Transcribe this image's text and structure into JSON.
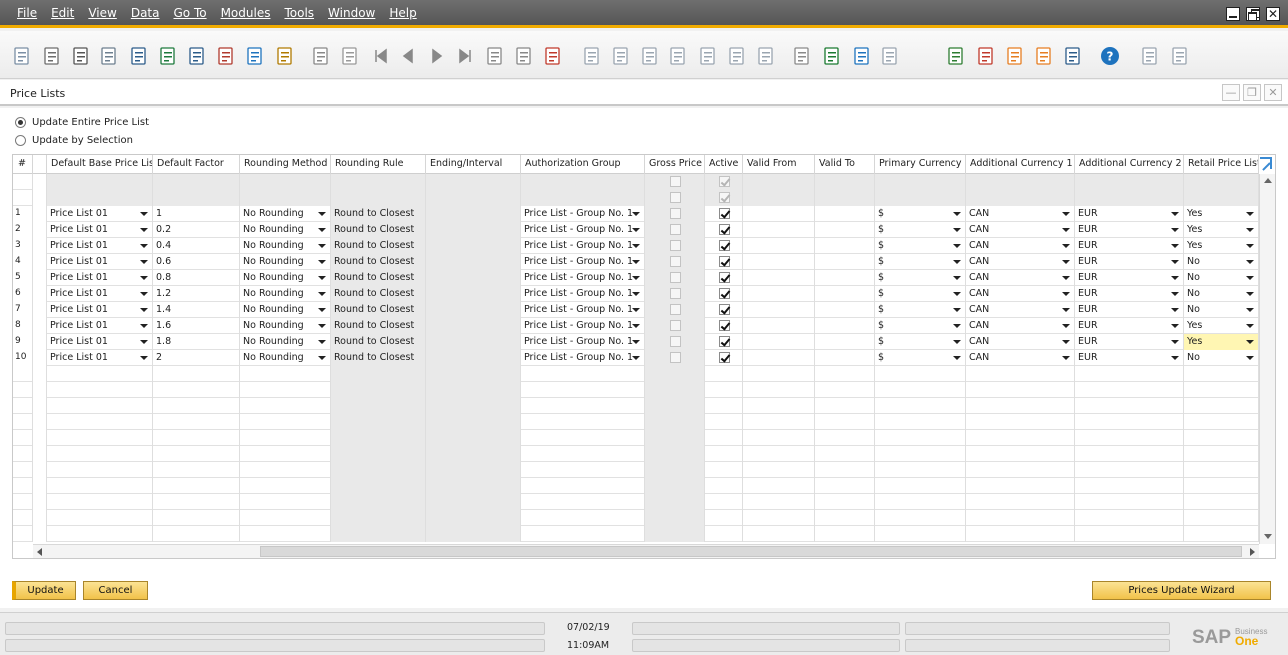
{
  "menu": {
    "items": [
      {
        "label": "File"
      },
      {
        "label": "Edit"
      },
      {
        "label": "View"
      },
      {
        "label": "Data"
      },
      {
        "label": "Go To"
      },
      {
        "label": "Modules"
      },
      {
        "label": "Tools"
      },
      {
        "label": "Window"
      },
      {
        "label": "Help"
      }
    ]
  },
  "window_controls": {
    "minimize": "_",
    "restore": "",
    "close": "✕"
  },
  "form": {
    "title": "Price Lists",
    "controls": {
      "minimize": "—",
      "restore": "❐",
      "close": "✕"
    }
  },
  "options": {
    "update_entire": "Update Entire Price List",
    "update_by_selection": "Update by Selection",
    "selected": "update_entire"
  },
  "grid": {
    "headers": [
      "#",
      "Default Base Price List",
      "Default Factor",
      "Rounding Method",
      "Rounding Rule",
      "Ending/Interval",
      "Authorization Group",
      "Gross Price",
      "Active",
      "Valid From",
      "Valid To",
      "Primary Currency",
      "Additional Currency 1",
      "Additional Currency 2",
      "Retail Price List"
    ],
    "rows": [
      {
        "num": "1",
        "base": "Price List 01",
        "factor": "1",
        "method": "No Rounding",
        "rule": "Round to Closest",
        "auth": "Price List - Group No. 1",
        "gross": false,
        "active": true,
        "primary": "$",
        "add1": "CAN",
        "add2": "EUR",
        "retail": "Yes"
      },
      {
        "num": "2",
        "base": "Price List 01",
        "factor": "0.2",
        "method": "No Rounding",
        "rule": "Round to Closest",
        "auth": "Price List - Group No. 1",
        "gross": false,
        "active": true,
        "primary": "$",
        "add1": "CAN",
        "add2": "EUR",
        "retail": "Yes"
      },
      {
        "num": "3",
        "base": "Price List 01",
        "factor": "0.4",
        "method": "No Rounding",
        "rule": "Round to Closest",
        "auth": "Price List - Group No. 1",
        "gross": false,
        "active": true,
        "primary": "$",
        "add1": "CAN",
        "add2": "EUR",
        "retail": "Yes"
      },
      {
        "num": "4",
        "base": "Price List 01",
        "factor": "0.6",
        "method": "No Rounding",
        "rule": "Round to Closest",
        "auth": "Price List - Group No. 1",
        "gross": false,
        "active": true,
        "primary": "$",
        "add1": "CAN",
        "add2": "EUR",
        "retail": "No"
      },
      {
        "num": "5",
        "base": "Price List 01",
        "factor": "0.8",
        "method": "No Rounding",
        "rule": "Round to Closest",
        "auth": "Price List - Group No. 1",
        "gross": false,
        "active": true,
        "primary": "$",
        "add1": "CAN",
        "add2": "EUR",
        "retail": "No"
      },
      {
        "num": "6",
        "base": "Price List 01",
        "factor": "1.2",
        "method": "No Rounding",
        "rule": "Round to Closest",
        "auth": "Price List - Group No. 1",
        "gross": false,
        "active": true,
        "primary": "$",
        "add1": "CAN",
        "add2": "EUR",
        "retail": "No"
      },
      {
        "num": "7",
        "base": "Price List 01",
        "factor": "1.4",
        "method": "No Rounding",
        "rule": "Round to Closest",
        "auth": "Price List - Group No. 1",
        "gross": false,
        "active": true,
        "primary": "$",
        "add1": "CAN",
        "add2": "EUR",
        "retail": "No"
      },
      {
        "num": "8",
        "base": "Price List 01",
        "factor": "1.6",
        "method": "No Rounding",
        "rule": "Round to Closest",
        "auth": "Price List - Group No. 1",
        "gross": false,
        "active": true,
        "primary": "$",
        "add1": "CAN",
        "add2": "EUR",
        "retail": "Yes"
      },
      {
        "num": "9",
        "base": "Price List 01",
        "factor": "1.8",
        "method": "No Rounding",
        "rule": "Round to Closest",
        "auth": "Price List - Group No. 1",
        "gross": false,
        "active": true,
        "primary": "$",
        "add1": "CAN",
        "add2": "EUR",
        "retail": "Yes",
        "highlight_retail": true
      },
      {
        "num": "10",
        "base": "Price List 01",
        "factor": "2",
        "method": "No Rounding",
        "rule": "Round to Closest",
        "auth": "Price List - Group No. 1",
        "gross": false,
        "active": true,
        "primary": "$",
        "add1": "CAN",
        "add2": "EUR",
        "retail": "No"
      }
    ]
  },
  "buttons": {
    "update": "Update",
    "cancel": "Cancel",
    "wizard": "Prices Update Wizard"
  },
  "status": {
    "date": "07/02/19",
    "time": "11:09AM"
  },
  "brand": {
    "logo": "SAP",
    "business": "Business",
    "one": "One"
  },
  "colors": {
    "accent": "#f0ab00",
    "button": "#f1c24a",
    "highlight": "#fff6b3",
    "sap_blue": "#1e73be"
  },
  "toolbar_icons": [
    "preview-icon",
    "print-icon",
    "email-icon",
    "sms-icon",
    "fax-icon",
    "excel-icon",
    "word-icon",
    "pdf-icon",
    "launch-app-icon",
    "lock-screen-icon",
    "find-icon",
    "add-icon",
    "first-record-icon",
    "previous-record-icon",
    "next-record-icon",
    "last-record-icon",
    "refresh-icon",
    "filter-icon",
    "sort-icon",
    "base-document-icon",
    "target-document-icon",
    "gross-profit-icon",
    "payment-icon",
    "journal-entry-icon",
    "relationship-map-icon",
    "transaction-icon",
    "settings-icon",
    "form-settings-icon",
    "notes-icon",
    "message-icon",
    "calendar-icon",
    "alerts-icon",
    "calculator-icon",
    "org-chart-icon",
    "user-icon",
    "help-icon",
    "customize-icon",
    "layout-icon"
  ]
}
